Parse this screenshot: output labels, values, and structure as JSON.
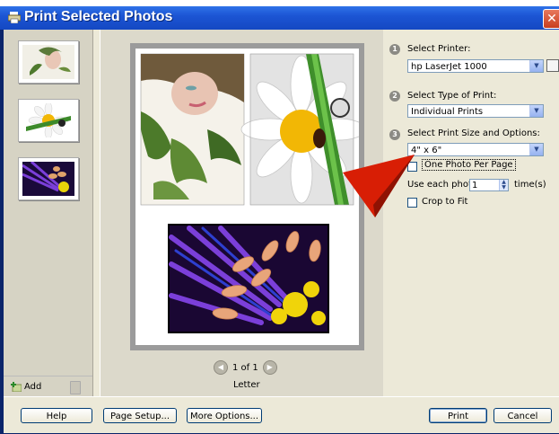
{
  "window": {
    "title": "Print Selected Photos",
    "close_glyph": "✕"
  },
  "left_panel": {
    "add_label": "Add"
  },
  "preview": {
    "page_indicator": "1 of 1",
    "paper_label": "Letter"
  },
  "options": {
    "printer_label": "Select Printer:",
    "printer_value": "hp LaserJet 1000",
    "print_type_label": "Select Type of Print:",
    "print_type_value": "Individual Prints",
    "size_label": "Select Print Size and Options:",
    "size_value": "4\" x 6\"",
    "one_photo_label": "One Photo Per Page",
    "use_each_label": "Use each photo",
    "times_value": "1",
    "times_label": "time(s)",
    "crop_label": "Crop to Fit"
  },
  "buttons": {
    "help": "Help",
    "page_setup": "Page Setup...",
    "more_options": "More Options...",
    "print": "Print",
    "cancel": "Cancel"
  },
  "colors": {
    "titlebar": "#1c55d4",
    "accent_red": "#d81e05",
    "dialog_bg": "#ece9d8"
  }
}
